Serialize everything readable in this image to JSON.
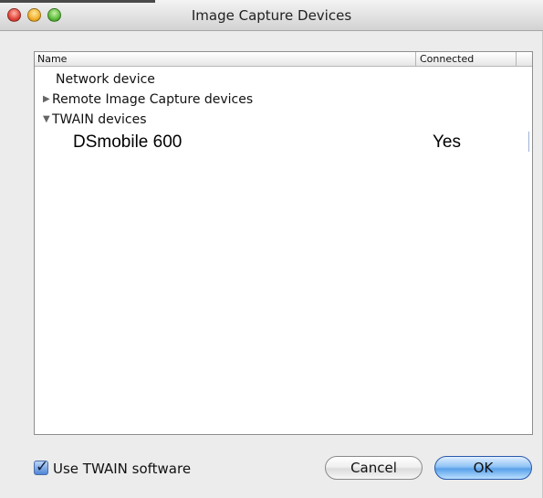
{
  "window": {
    "title": "Image Capture Devices"
  },
  "list": {
    "columns": {
      "name": "Name",
      "connected": "Connected"
    },
    "rows": [
      {
        "label": "Network device",
        "expander": ""
      },
      {
        "label": "Remote Image Capture devices",
        "expander": "collapsed"
      },
      {
        "label": "TWAIN devices",
        "expander": "expanded"
      },
      {
        "label": "DSmobile 600",
        "connected": "Yes"
      }
    ]
  },
  "footer": {
    "checkbox_label": "Use TWAIN software",
    "checkbox_checked": true,
    "cancel_label": "Cancel",
    "ok_label": "OK"
  },
  "icons": {
    "close": "close-icon",
    "minimize": "minimize-icon",
    "zoom": "zoom-icon",
    "collapsed": "triangle-right-icon",
    "expanded": "triangle-down-icon",
    "check": "checkmark-icon"
  }
}
